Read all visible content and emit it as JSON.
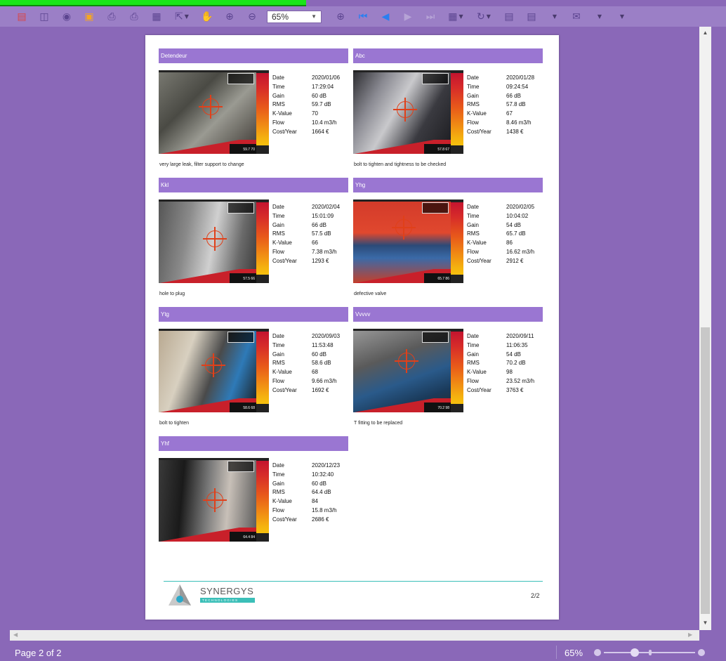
{
  "toolbar": {
    "zoom_value": "65%",
    "icons": [
      "pdf-icon",
      "panels-icon",
      "binoculars-icon",
      "open-folder-icon",
      "print-icon",
      "print-setup-icon",
      "print-preview-icon",
      "fit-page-icon",
      "hand-icon",
      "zoom-in-tool-icon",
      "zoom-out-icon",
      "zoom-in-icon",
      "first-page-icon",
      "previous-page-icon",
      "next-page-icon",
      "last-page-icon",
      "layout-icon",
      "rotate-icon",
      "document-icon",
      "export-icon",
      "mail-icon"
    ]
  },
  "report": {
    "labels": {
      "date": "Date",
      "time": "Time",
      "gain": "Gain",
      "rms": "RMS",
      "kvalue": "K-Value",
      "flow": "Flow",
      "cost": "Cost/Year"
    },
    "cards": [
      {
        "title": "Detendeur",
        "date": "2020/01/06",
        "time": "17:29:04",
        "gain": "60 dB",
        "rms": "59.7 dB",
        "kvalue": "70",
        "flow": "10.4 m3/h",
        "cost": "1664 €",
        "caption": "very large leak, filter support to change",
        "db": "59.7  70"
      },
      {
        "title": "Abc",
        "date": "2020/01/28",
        "time": "09:24:54",
        "gain": "66 dB",
        "rms": "57.8 dB",
        "kvalue": "67",
        "flow": "8.46 m3/h",
        "cost": "1438 €",
        "caption": "bolt to tighten and tightness to be checked",
        "db": "57.8  67"
      },
      {
        "title": "Kkl",
        "date": "2020/02/04",
        "time": "15:01:09",
        "gain": "66 dB",
        "rms": "57.5 dB",
        "kvalue": "66",
        "flow": "7.38 m3/h",
        "cost": "1293 €",
        "caption": "hole to plug",
        "db": "57.5  66"
      },
      {
        "title": "Yhg",
        "date": "2020/02/05",
        "time": "10:04:02",
        "gain": "54 dB",
        "rms": "65.7 dB",
        "kvalue": "86",
        "flow": "16.62 m3/h",
        "cost": "2912 €",
        "caption": "defective valve",
        "db": "65.7  86"
      },
      {
        "title": "Ytg",
        "date": "2020/09/03",
        "time": "11:53:48",
        "gain": "60 dB",
        "rms": "58.6 dB",
        "kvalue": "68",
        "flow": "9.66 m3/h",
        "cost": "1692 €",
        "caption": "bolt to tighten",
        "db": "58.6  68"
      },
      {
        "title": "Vvvvv",
        "date": "2020/09/11",
        "time": "11:06:35",
        "gain": "54 dB",
        "rms": "70.2 dB",
        "kvalue": "98",
        "flow": "23.52 m3/h",
        "cost": "3763 €",
        "caption": "T fitting to be replaced",
        "db": "70.2  98"
      },
      {
        "title": "Yhf",
        "date": "2020/12/23",
        "time": "10:32:40",
        "gain": "60 dB",
        "rms": "64.4 dB",
        "kvalue": "84",
        "flow": "15.8 m3/h",
        "cost": "2686 €",
        "caption": "",
        "db": "64.4  84"
      }
    ],
    "footer": {
      "brand": "SYNERGYS",
      "brand_sub": "TECHNOLOGIES",
      "page_number": "2/2"
    }
  },
  "status": {
    "page_label": "Page 2 of 2",
    "zoom_label": "65%",
    "zoom_slider_percent": 65
  },
  "colors": {
    "chrome": "#8a68b8",
    "card_header": "#9a76d2",
    "accent": "#3bbfb8"
  }
}
